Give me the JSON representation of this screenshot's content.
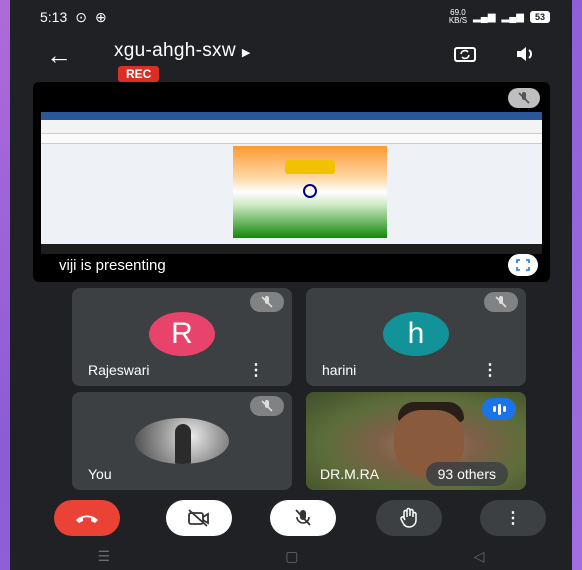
{
  "status": {
    "time": "5:13",
    "net_rate": "69.0",
    "net_unit": "KB/S",
    "battery": "53"
  },
  "header": {
    "meeting_code": "xgu-ahgh-sxw",
    "rec_label": "REC"
  },
  "presentation": {
    "label": "viji is presenting"
  },
  "participants": [
    {
      "name": "Rajeswari",
      "initial": "R",
      "color": "#e8436b"
    },
    {
      "name": "harini",
      "initial": "h",
      "color": "#12939a"
    },
    {
      "name": "You"
    },
    {
      "name": "DR.M.RA"
    }
  ],
  "others": "93 others",
  "colors": {
    "end_call": "#ea4335",
    "background": "#202124",
    "tile": "#3c4043"
  },
  "icons": [
    "back-arrow-icon",
    "switch-camera-icon",
    "speaker-icon",
    "mic-off-icon",
    "fullscreen-icon",
    "more-vert-icon",
    "hang-up-icon",
    "camera-off-icon",
    "raise-hand-icon"
  ]
}
